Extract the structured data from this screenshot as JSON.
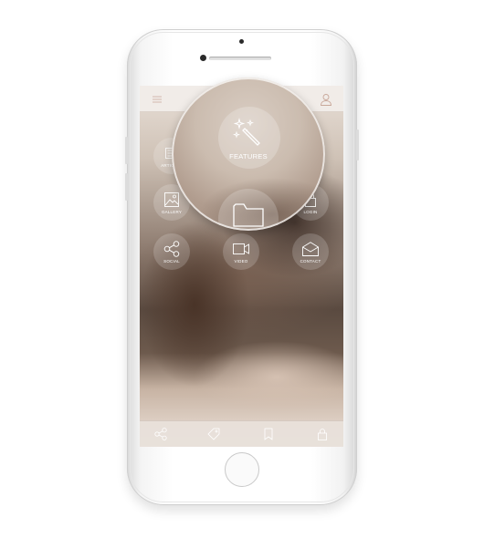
{
  "screen": {
    "grid": [
      {
        "label": "ARTICLES",
        "icon": "article-icon"
      },
      {
        "label": "GALLERY",
        "icon": "image-icon"
      },
      {
        "label": "LOGIN",
        "icon": "lock-icon"
      },
      {
        "label": "SOCIAL",
        "icon": "share-icon"
      },
      {
        "label": "VIDEO",
        "icon": "video-camera-icon"
      },
      {
        "label": "CONTACT",
        "icon": "envelope-icon"
      }
    ],
    "magnifier": {
      "label": "FEATURES",
      "icon": "magic-wand-icon",
      "secondary_icon": "folder-icon"
    },
    "topbar": {
      "left_icon": "menu-icon",
      "right_icon": "user-icon"
    },
    "bottombar": {
      "icons": [
        "share-icon",
        "tag-icon",
        "bookmark-icon",
        "lock-icon"
      ]
    }
  }
}
